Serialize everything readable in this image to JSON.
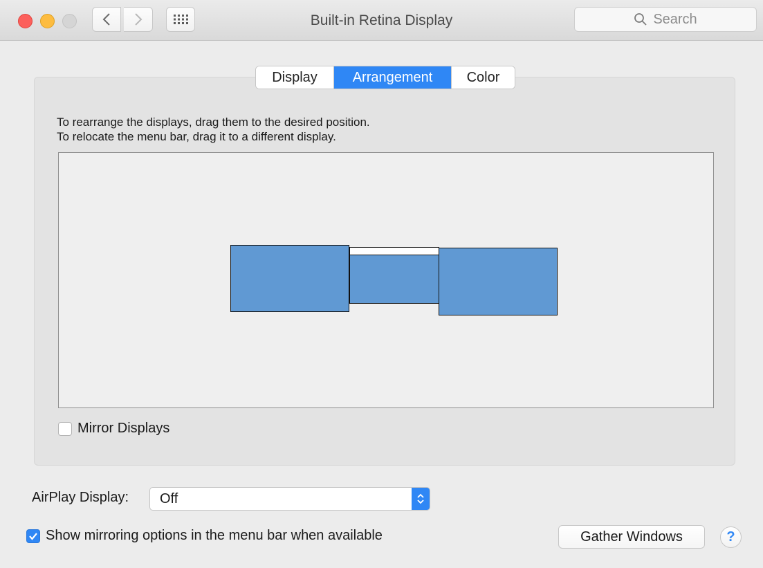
{
  "window": {
    "title": "Built-in Retina Display"
  },
  "toolbar": {
    "back_icon": "chevron-left-icon",
    "forward_icon": "chevron-right-icon",
    "grid_icon": "grid-icon",
    "search_placeholder": "Search"
  },
  "tabs": [
    {
      "label": "Display",
      "selected": false
    },
    {
      "label": "Arrangement",
      "selected": true
    },
    {
      "label": "Color",
      "selected": false
    }
  ],
  "arrangement": {
    "instruction_line1": "To rearrange the displays, drag them to the desired position.",
    "instruction_line2": "To relocate the menu bar, drag it to a different display.",
    "displays": [
      "display-left",
      "display-main",
      "display-right"
    ]
  },
  "mirror": {
    "label": "Mirror Displays",
    "checked": false
  },
  "airplay": {
    "label": "AirPlay Display:",
    "value": "Off"
  },
  "show_mirroring": {
    "label": "Show mirroring options in the menu bar when available",
    "checked": true
  },
  "buttons": {
    "gather": "Gather Windows",
    "help": "?"
  },
  "colors": {
    "accent": "#2f87f5",
    "display_fill": "#6099d3"
  }
}
